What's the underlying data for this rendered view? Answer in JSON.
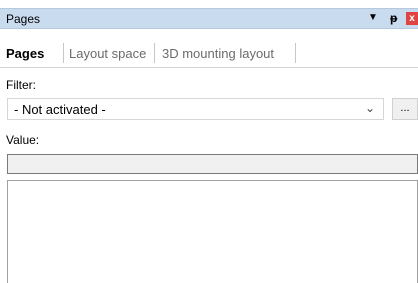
{
  "panel": {
    "title": "Pages",
    "dropdown_icon": "▼",
    "pin_icon": "ᵽ",
    "close_icon": "x"
  },
  "tabs": [
    {
      "label": "Pages",
      "active": true
    },
    {
      "label": "Layout space",
      "active": false
    },
    {
      "label": "3D mounting layout",
      "active": false
    }
  ],
  "filter": {
    "label": "Filter:",
    "selected": "- Not activated -",
    "chevron_icon": "⌄",
    "browse_label": "..."
  },
  "value": {
    "label": "Value:",
    "text": ""
  }
}
